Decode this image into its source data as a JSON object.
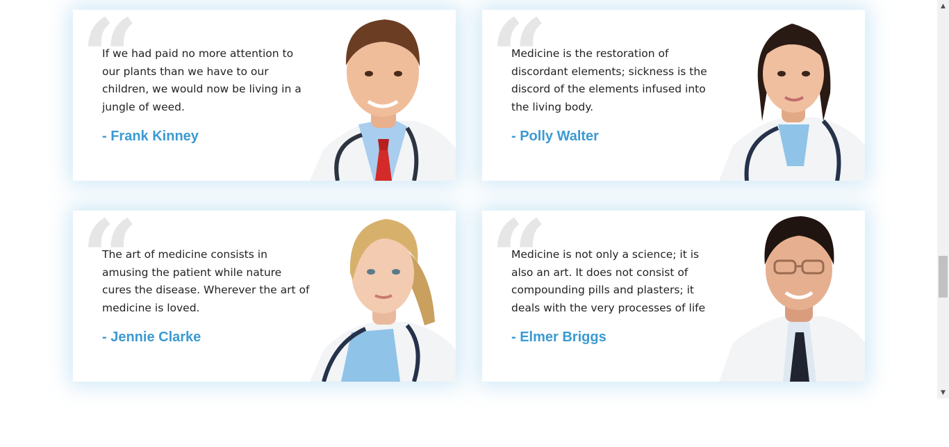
{
  "testimonials": [
    {
      "quote": "If we had paid no more attention to our plants than we have to our children, we would now be living in a jungle of weed.",
      "author": "- Frank Kinney",
      "photo_icon": "male-doctor-portrait-icon"
    },
    {
      "quote": "Medicine is the restoration of discordant elements; sickness is the discord of the elements infused into the living body.",
      "author": "- Polly Walter",
      "photo_icon": "female-doctor-portrait-icon"
    },
    {
      "quote": "The art of medicine consists in amusing the patient while nature cures the disease. Wherever the art of medicine is loved.",
      "author": "- Jennie Clarke",
      "photo_icon": "female-doctor-portrait-icon"
    },
    {
      "quote": "Medicine is not only a science; it is also an art. It does not consist of compounding pills and plasters; it deals with the very processes of life",
      "author": "- Elmer Briggs",
      "photo_icon": "male-doctor-portrait-icon"
    }
  ],
  "quote_glyph": "“",
  "colors": {
    "author": "#3b9ad2",
    "quote_mark": "#e6e6e6",
    "card_glow": "#9fd3f0",
    "coat": "#f2f4f6",
    "scrub": "#8fc3e8"
  },
  "scrollbar": {
    "up": "▲",
    "down": "▼"
  }
}
